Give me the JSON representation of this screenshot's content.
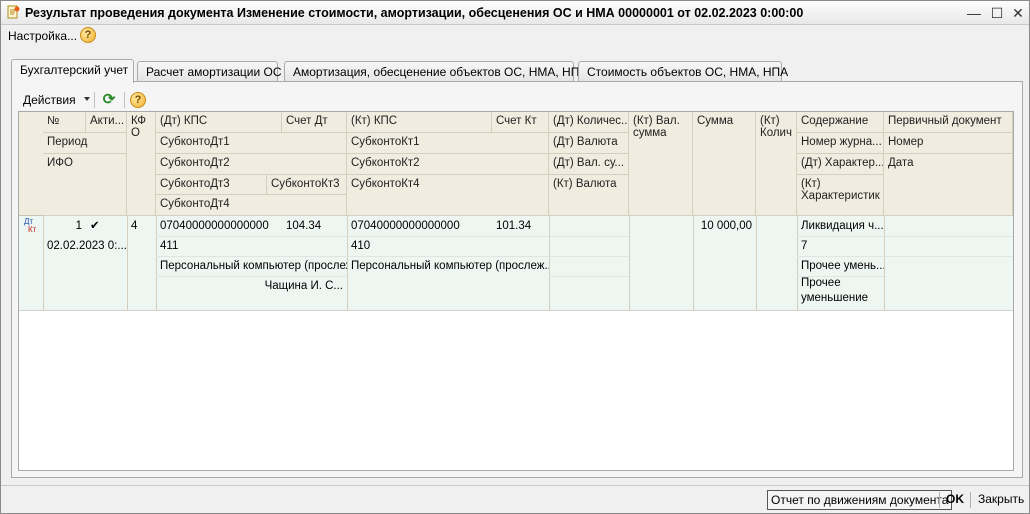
{
  "window": {
    "title": "Результат проведения документа Изменение стоимости, амортизации, обесценения ОС и НМА 00000001 от 02.02.2023 0:00:00",
    "minimize": "—",
    "maximize": "☐",
    "close": "✕"
  },
  "menubar": {
    "settings_label": "Настройка...",
    "help_label": "?"
  },
  "tabs": [
    {
      "label": "Бухгалтерский учет",
      "active": true
    },
    {
      "label": "Расчет амортизации ОС",
      "active": false
    },
    {
      "label": "Амортизация, обесценение объектов ОС, НМА, НПА",
      "active": false
    },
    {
      "label": "Стоимость объектов ОС, НМА, НПА",
      "active": false
    }
  ],
  "toolbar": {
    "actions_label": "Действия",
    "refresh_icon": "refresh-icon",
    "help_label": "?"
  },
  "grid": {
    "headers": {
      "num": "№",
      "active": "Акти...",
      "period": "Период",
      "ifo": "ИФО",
      "kfo": "КФО",
      "dt_kps": "(Дт) КПС",
      "dt_account": "Счет Дт",
      "dt_sub1": "СубконтоДт1",
      "dt_sub2": "СубконтоДт2",
      "dt_sub3": "СубконтоДт3",
      "kt_sub3": "СубконтоКт3",
      "dt_sub4": "СубконтоДт4",
      "kt_kps": "(Кт) КПС",
      "kt_account": "Счет Кт",
      "kt_sub1": "СубконтоКт1",
      "kt_sub2": "СубконтоКт2",
      "kt_sub4": "СубконтоКт4",
      "dt_qty": "(Дт) Количес...",
      "dt_currency": "(Дт) Валюта",
      "dt_cur_sum": "(Дт) Вал. су...",
      "kt_currency": "(Кт) Валюта",
      "kt_cur_sum": "(Кт) Вал. сумма",
      "sum": "Сумма",
      "kt_qty": "(Кт) Колич",
      "content": "Содержание",
      "journal_num": "Номер журна...",
      "dt_char": "(Дт) Характер...",
      "kt_char": "(Кт) Характеристик",
      "primary_doc": "Первичный документ",
      "doc_number": "Номер",
      "doc_date": "Дата"
    },
    "rows": [
      {
        "dt_label": "Дт",
        "kt_label": "Кт",
        "num": "1",
        "active_mark": "✔",
        "period": "02.02.2023 0:...",
        "kfo": "4",
        "dt_kps": "07040000000000000",
        "dt_account": "104.34",
        "dt_sub1": "411",
        "dt_sub2": "Персональный компьютер (прослеж...",
        "kt_sub3": "Чащина И. С...",
        "kt_kps": "07040000000000000",
        "kt_account": "101.34",
        "kt_sub1": "410",
        "kt_sub2": "Персональный компьютер (прослеж...",
        "sum": "10 000,00",
        "content": "Ликвидация ч...",
        "journal_num": "7",
        "dt_char": "Прочее умень...",
        "kt_char": "Прочее уменьшение"
      }
    ]
  },
  "bottombar": {
    "report_label": "Отчет по движениям документа",
    "ok_label": "OK",
    "close_label": "Закрыть"
  }
}
